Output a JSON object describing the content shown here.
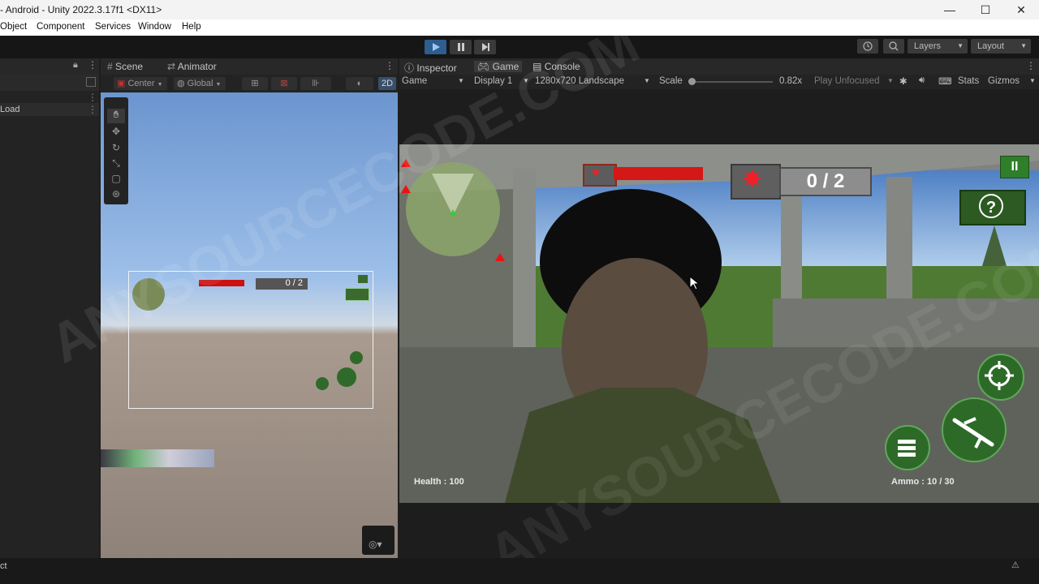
{
  "window": {
    "title": "- Android - Unity 2022.3.17f1 <DX11>",
    "controls": [
      "—",
      "☐",
      "✕"
    ]
  },
  "menu": [
    "Object",
    "Component",
    "Services",
    "Window",
    "Help"
  ],
  "toolbar": {
    "layers_label": "Layers",
    "layout_label": "Layout"
  },
  "hierarchy": {
    "item": "Load"
  },
  "scene_panel": {
    "tabs": [
      "Scene",
      "Animator"
    ],
    "pivot_label": "Center",
    "space_label": "Global",
    "mode_2d": "2D",
    "mini_score": "0 / 2"
  },
  "game_panel": {
    "tabs": [
      "Inspector",
      "Game",
      "Console"
    ],
    "view_label": "Game",
    "display_label": "Display 1",
    "resolution_label": "1280x720 Landscape",
    "scale_label": "Scale",
    "scale_value": "0.82x",
    "play_focus_label": "Play Unfocused",
    "stats_label": "Stats",
    "gizmos_label": "Gizmos"
  },
  "hud": {
    "score": "0 / 2",
    "health_text": "Health : 100",
    "ammo_text": "Ammo : 10 / 30",
    "health_fill": 1.0,
    "help_glyph": "?",
    "pause_glyph": "II"
  },
  "watermark": "ANYSOURCECODE.COM",
  "statusbar": {
    "left_text": "ct"
  }
}
